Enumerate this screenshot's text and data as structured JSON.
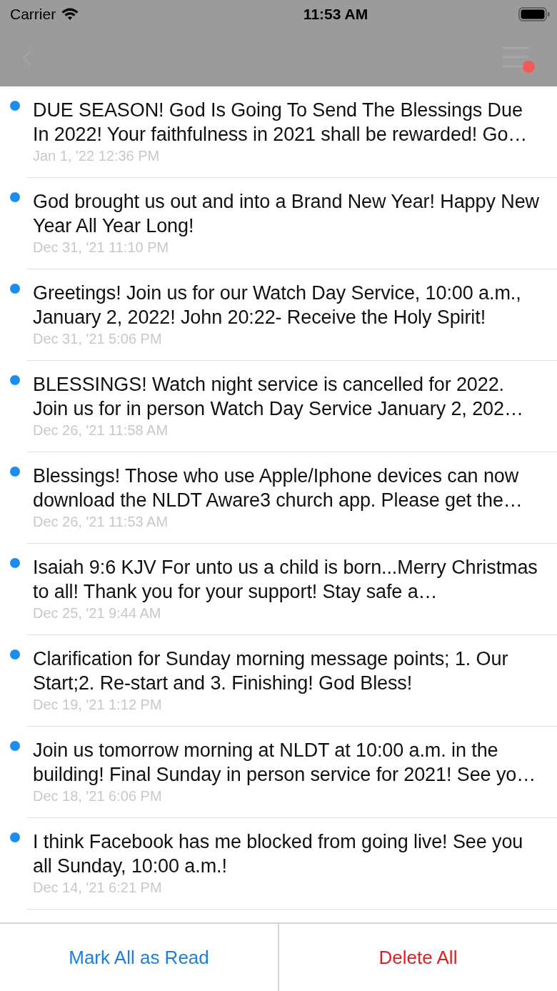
{
  "status_bar": {
    "carrier": "Carrier",
    "time": "11:53 AM"
  },
  "nav_bar": {
    "unread_indicator": true
  },
  "messages": [
    {
      "text": "DUE SEASON! God Is Going To Send The Blessings Due In 2022! Your faithfulness in 2021 shall be rewarded! Go…",
      "date": "Jan 1, '22 12:36 PM",
      "unread": true
    },
    {
      "text": "God brought us out and into a Brand New Year! Happy New Year All Year Long!",
      "date": "Dec 31, '21 11:10 PM",
      "unread": true
    },
    {
      "text": "Greetings! Join us for our Watch Day Service, 10:00 a.m., January 2, 2022! John 20:22- Receive the Holy Spirit!",
      "date": "Dec 31, '21 5:06 PM",
      "unread": true
    },
    {
      "text": "BLESSINGS! Watch night service is cancelled for 2022. Join us for in person Watch Day Service January 2, 202…",
      "date": "Dec 26, '21 11:58 AM",
      "unread": true
    },
    {
      "text": "Blessings! Those who use Apple/Iphone devices can now download the NLDT Aware3 church app. Please get the…",
      "date": "Dec 26, '21 11:53 AM",
      "unread": true
    },
    {
      "text": "Isaiah 9:6 KJV For unto us a child is born...Merry Christmas to all! Thank you for your support! Stay safe a…",
      "date": "Dec 25, '21 9:44 AM",
      "unread": true
    },
    {
      "text": "Clarification for Sunday morning message points; 1. Our Start;2. Re-start and 3. Finishing! God Bless!",
      "date": "Dec 19, '21 1:12 PM",
      "unread": true
    },
    {
      "text": "Join us tomorrow morning at NLDT at 10:00 a.m. in the building! Final Sunday in person service for 2021! See yo…",
      "date": "Dec 18, '21 6:06 PM",
      "unread": true
    },
    {
      "text": "I think Facebook has me blocked from going live! See you all Sunday, 10:00 a.m.!",
      "date": "Dec 14, '21 6:21 PM",
      "unread": true
    }
  ],
  "actions": [
    {
      "label": "Mark All as Read",
      "kind": "primary"
    },
    {
      "label": "Delete All",
      "kind": "destructive"
    }
  ]
}
